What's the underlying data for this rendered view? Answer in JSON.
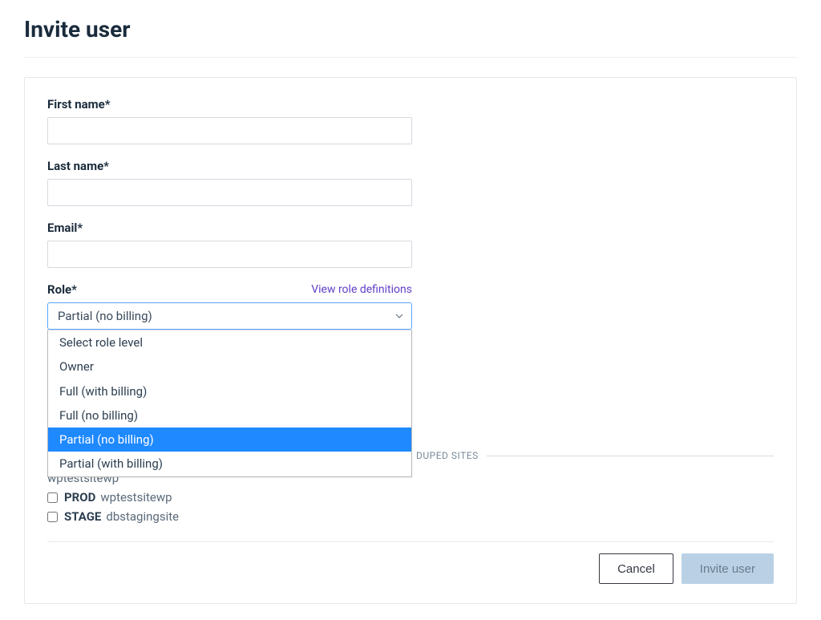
{
  "page": {
    "title": "Invite user"
  },
  "form": {
    "first_name": {
      "label": "First name*",
      "value": ""
    },
    "last_name": {
      "label": "Last name*",
      "value": ""
    },
    "email": {
      "label": "Email*",
      "value": ""
    },
    "role": {
      "label": "Role*",
      "definitions_link": "View role definitions",
      "selected": "Partial (no billing)",
      "options": [
        "Select role level",
        "Owner",
        "Full (with billing)",
        "Full (no billing)",
        "Partial (no billing)",
        "Partial (with billing)"
      ]
    }
  },
  "sites_section": {
    "divider_label": "DUPED SITES",
    "group_name": "wptestsitewp",
    "rows": [
      {
        "env": "PROD",
        "name": "wptestsitewp",
        "checked": false
      },
      {
        "env": "STAGE",
        "name": "dbstagingsite",
        "checked": false
      }
    ]
  },
  "actions": {
    "cancel": "Cancel",
    "invite": "Invite user"
  }
}
